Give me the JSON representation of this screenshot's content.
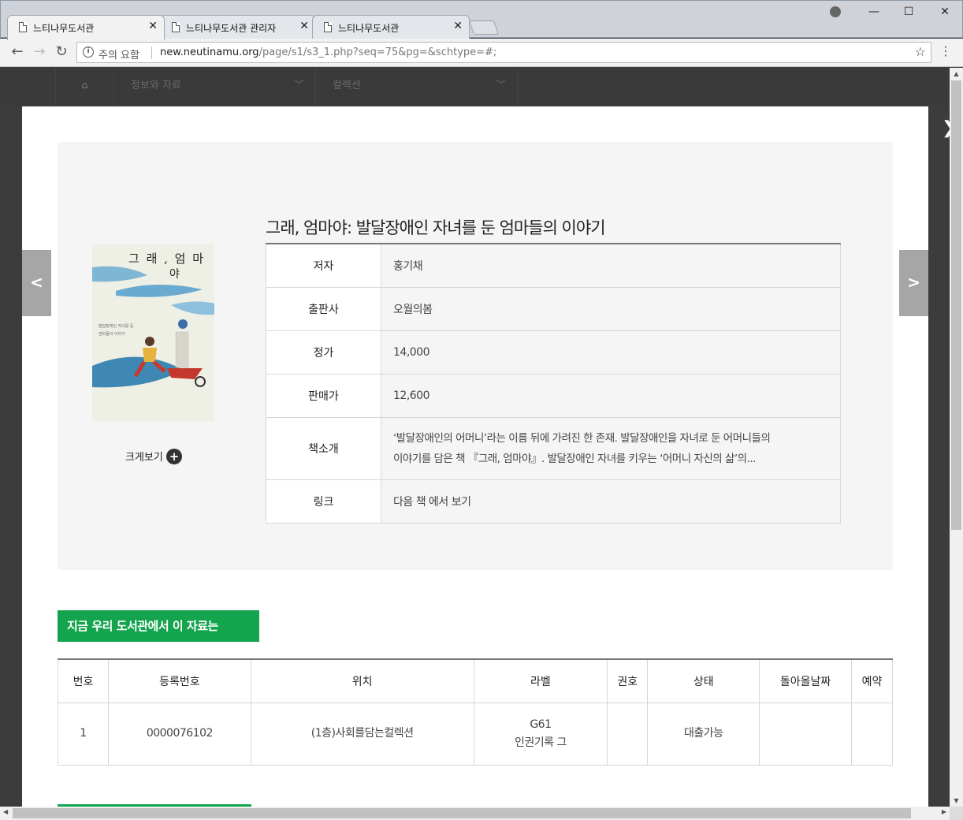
{
  "browser": {
    "tabs": [
      {
        "title": "느티나무도서관"
      },
      {
        "title": "느티나무도서관 관리자"
      },
      {
        "title": "느티나무도서관"
      }
    ],
    "security_label": "주의 요함",
    "url_host": "new.neutinamu.org",
    "url_path": "/page/s1/s3_1.php?seq=75&pg=&schtype=#;"
  },
  "site_nav": {
    "home_icon": "home-icon",
    "menus": [
      {
        "label": "정보와 자료"
      },
      {
        "label": "컬렉션"
      }
    ]
  },
  "book": {
    "title": "그래, 엄마야: 발달장애인 자녀를 둔 엄마들의 이야기",
    "cover": {
      "title_line1": "그 래 , 엄 마",
      "title_line2": "야",
      "subtitle_line1": "발달장애인 자녀를 둔",
      "subtitle_line2": "엄마들의 이야기"
    },
    "zoom_label": "크게보기",
    "fields": {
      "author_label": "저자",
      "author": "홍기채",
      "publisher_label": "출판사",
      "publisher": "오월의봄",
      "price_label": "정가",
      "price": "14,000",
      "sale_price_label": "판매가",
      "sale_price": "12,600",
      "intro_label": "책소개",
      "intro_line1": "‘발달장애인의 어머니’라는 이름 뒤에 가려진 한 존재. 발달장애인을 자녀로 둔 어머니들의",
      "intro_line2": "이야기를 담은 책 『그래, 엄마야』. 발달장애인 자녀를 키우는 ‘어머니 자신의 삶’의...",
      "link_label": "링크",
      "link_text": "다음 책 에서 보기"
    }
  },
  "nav": {
    "prev": "<",
    "next": ">"
  },
  "holdings": {
    "heading": "지금 우리 도서관에서 이 자료는",
    "columns": [
      "번호",
      "등록번호",
      "위치",
      "라벨",
      "권호",
      "상태",
      "돌아올날짜",
      "예약"
    ],
    "rows": [
      {
        "no": "1",
        "reg_no": "0000076102",
        "location": "(1층)사회를담는컬렉션",
        "label_line1": "G61",
        "label_line2": "인권기록 그",
        "volume": "",
        "status": "대출가능",
        "return_date": "",
        "reserve": ""
      }
    ]
  },
  "colors": {
    "accent_green": "#14a44d",
    "panel_bg": "#f5f5f5",
    "arrow_bg": "#a6a6a6"
  }
}
